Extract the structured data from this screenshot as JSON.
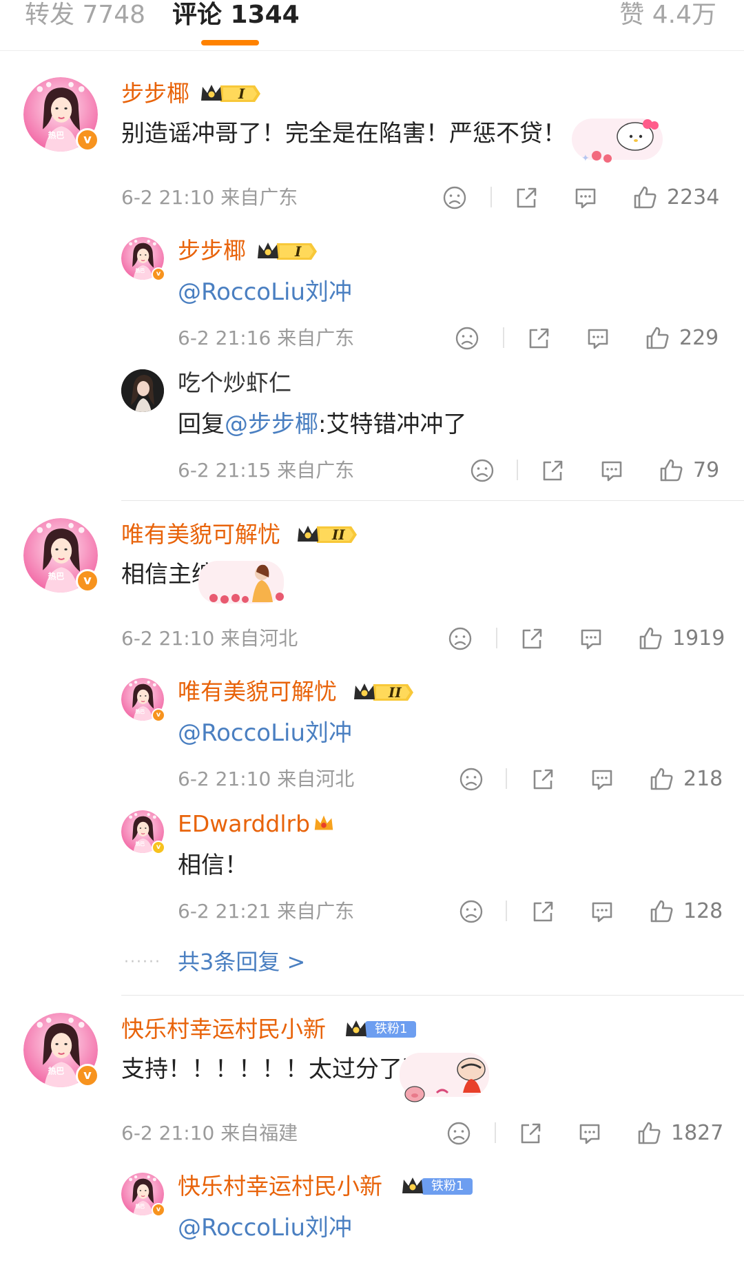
{
  "tabs": {
    "repost": "转发 7748",
    "comments": "评论 1344",
    "likes": "赞 4.4万"
  },
  "colors": {
    "accent": "#ff8200",
    "username": "#e8630a",
    "link": "#4a7fc1",
    "meta": "#9b9b9b"
  },
  "threads": [
    {
      "main": {
        "user": "步步椰",
        "badge": "I",
        "text": "别造谣冲哥了！完全是在陷害！严惩不贷！",
        "time": "6-2 21:10",
        "location": "来自广东",
        "likes": "2234"
      },
      "replies": [
        {
          "user": "步步椰",
          "badge": "I",
          "mention": "@RoccoLiu",
          "text": "刘冲",
          "time": "6-2 21:16",
          "location": "来自广东",
          "likes": "229"
        },
        {
          "user": "吃个炒虾仁",
          "prefix": "回复",
          "mention": "@步步椰",
          "text": ":艾特错冲冲了",
          "time": "6-2 21:15",
          "location": "来自广东",
          "likes": "79"
        }
      ]
    },
    {
      "main": {
        "user": "唯有美貌可解忧",
        "badge": "II",
        "text": "相信主编",
        "time": "6-2 21:10",
        "location": "来自河北",
        "likes": "1919"
      },
      "replies": [
        {
          "user": "唯有美貌可解忧",
          "badge": "II",
          "mention": "@RoccoLiu",
          "text": "刘冲",
          "time": "6-2 21:10",
          "location": "来自河北",
          "likes": "218"
        },
        {
          "user": "EDwarddlrb",
          "text": "相信！",
          "time": "6-2 21:21",
          "location": "来自广东",
          "likes": "128"
        }
      ],
      "more": "共3条回复 >"
    },
    {
      "main": {
        "user": "快乐村幸运村民小新",
        "badge": "铁粉1",
        "text": "支持！！！！！！太过分了这也",
        "time": "6-2 21:10",
        "location": "来自福建",
        "likes": "1827"
      },
      "replies": [
        {
          "user": "快乐村幸运村民小新",
          "badge": "铁粉1",
          "mention": "@RoccoLiu",
          "text": "刘冲"
        }
      ]
    }
  ]
}
